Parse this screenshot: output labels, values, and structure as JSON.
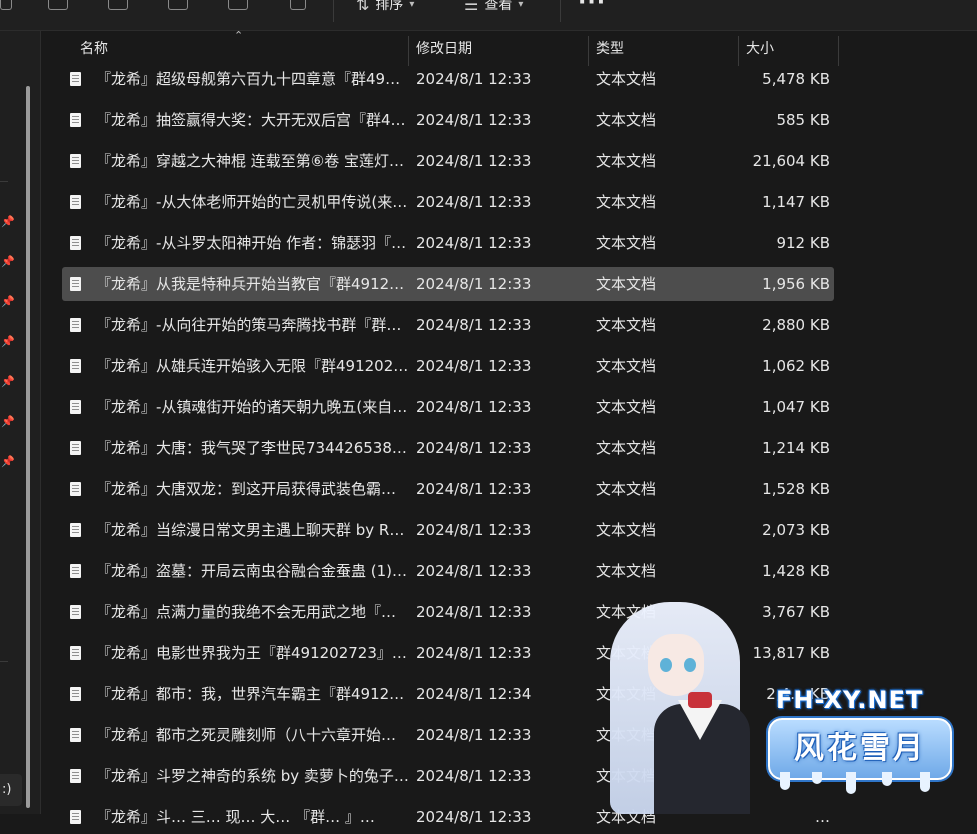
{
  "columns": {
    "name": "名称",
    "date": "修改日期",
    "type": "类型",
    "size": "大小"
  },
  "toolbar": {
    "sort_label": "排序",
    "view_label": "查看",
    "more": "···"
  },
  "nav": {
    "fragment": ":)"
  },
  "files": [
    {
      "name": "『龙希』超级母舰第六百九十四章意『群49…",
      "date": "2024/8/1 12:33",
      "type": "文本文档",
      "size": "5,478 KB"
    },
    {
      "name": "『龙希』抽签赢得大奖：大开无双后宫『群4…",
      "date": "2024/8/1 12:33",
      "type": "文本文档",
      "size": "585 KB"
    },
    {
      "name": "『龙希』穿越之大神棍 连载至第⑥卷 宝莲灯…",
      "date": "2024/8/1 12:33",
      "type": "文本文档",
      "size": "21,604 KB"
    },
    {
      "name": "『龙希』-从大体老师开始的亡灵机甲传说(来…",
      "date": "2024/8/1 12:33",
      "type": "文本文档",
      "size": "1,147 KB"
    },
    {
      "name": "『龙希』-从斗罗太阳神开始 作者：锦瑟羽『…",
      "date": "2024/8/1 12:33",
      "type": "文本文档",
      "size": "912 KB"
    },
    {
      "name": "『龙希』从我是特种兵开始当教官『群4912…",
      "date": "2024/8/1 12:33",
      "type": "文本文档",
      "size": "1,956 KB"
    },
    {
      "name": "『龙希』-从向往开始的策马奔腾找书群『群…",
      "date": "2024/8/1 12:33",
      "type": "文本文档",
      "size": "2,880 KB"
    },
    {
      "name": "『龙希』从雄兵连开始骇入无限『群491202…",
      "date": "2024/8/1 12:33",
      "type": "文本文档",
      "size": "1,062 KB"
    },
    {
      "name": "『龙希』-从镇魂街开始的诸天朝九晚五(来自…",
      "date": "2024/8/1 12:33",
      "type": "文本文档",
      "size": "1,047 KB"
    },
    {
      "name": "『龙希』大唐：我气哭了李世民734426538…",
      "date": "2024/8/1 12:33",
      "type": "文本文档",
      "size": "1,214 KB"
    },
    {
      "name": "『龙希』大唐双龙：到这开局获得武装色霸…",
      "date": "2024/8/1 12:33",
      "type": "文本文档",
      "size": "1,528 KB"
    },
    {
      "name": "『龙希』当综漫日常文男主遇上聊天群 by R…",
      "date": "2024/8/1 12:33",
      "type": "文本文档",
      "size": "2,073 KB"
    },
    {
      "name": "『龙希』盗墓：开局云南虫谷融合金蚕蛊 (1)…",
      "date": "2024/8/1 12:33",
      "type": "文本文档",
      "size": "1,428 KB"
    },
    {
      "name": "『龙希』点满力量的我绝不会无用武之地『…",
      "date": "2024/8/1 12:33",
      "type": "文本文档",
      "size": "3,767 KB"
    },
    {
      "name": "『龙希』电影世界我为王『群491202723』…",
      "date": "2024/8/1 12:33",
      "type": "文本文档",
      "size": "13,817 KB"
    },
    {
      "name": "『龙希』都市：我，世界汽车霸主『群4912…",
      "date": "2024/8/1 12:34",
      "type": "文本文档",
      "size": "2,4… KB"
    },
    {
      "name": "『龙希』都市之死灵雕刻师（八十六章开始…",
      "date": "2024/8/1 12:33",
      "type": "文本文档",
      "size": ""
    },
    {
      "name": "『龙希』斗罗之神奇的系统 by 卖萝卜的兔子…",
      "date": "2024/8/1 12:33",
      "type": "文本文档",
      "size": ""
    },
    {
      "name": "『龙希』斗… 三… 现… 大… 『群… 』…",
      "date": "2024/8/1 12:33",
      "type": "文本文档",
      "size": "…"
    }
  ],
  "selected_index": 5,
  "watermark": {
    "site": "FH-XY.NET",
    "banner": "风花雪月"
  },
  "colors": {
    "background": "#191919",
    "selection": "#4d4d4d",
    "text": "#e6e6e6"
  }
}
